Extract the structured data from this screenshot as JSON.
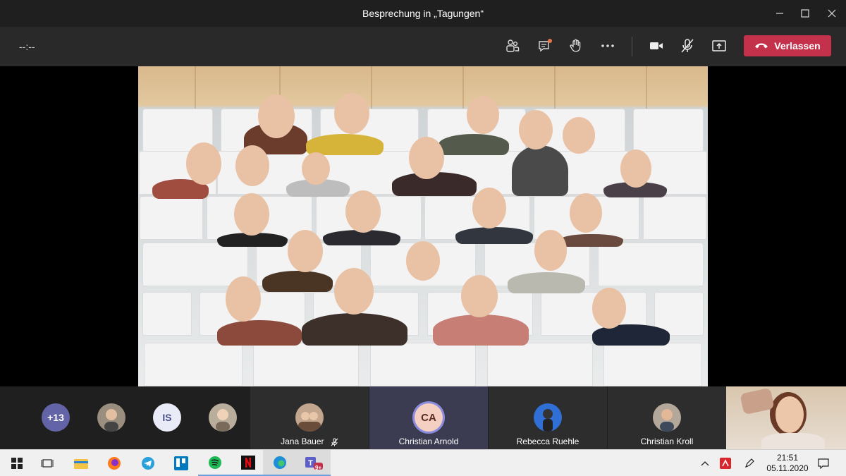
{
  "window": {
    "title": "Besprechung in „Tagungen“"
  },
  "controls": {
    "timer": "--:--",
    "leave_label": "Verlassen",
    "colors": {
      "leave": "#c4314b",
      "bar": "#292929",
      "accent": "#8a8cdb"
    }
  },
  "participants": {
    "overflow_count": "+13",
    "initials_avatar": "IS",
    "tiles": [
      {
        "name": "Jana Bauer",
        "muted": true
      },
      {
        "name": "Christian Arnold",
        "initials": "CA",
        "speaking": true
      },
      {
        "name": "Rebecca Ruehle"
      },
      {
        "name": "Christian Kroll"
      }
    ]
  },
  "taskbar": {
    "apps": [
      "start-icon",
      "task-view-icon",
      "file-explorer-icon",
      "firefox-icon",
      "telegram-icon",
      "trello-icon",
      "spotify-icon",
      "netflix-icon",
      "edge-icon",
      "teams-icon"
    ],
    "teams_badge": "9+",
    "time": "21:51",
    "date": "05.11.2020"
  }
}
